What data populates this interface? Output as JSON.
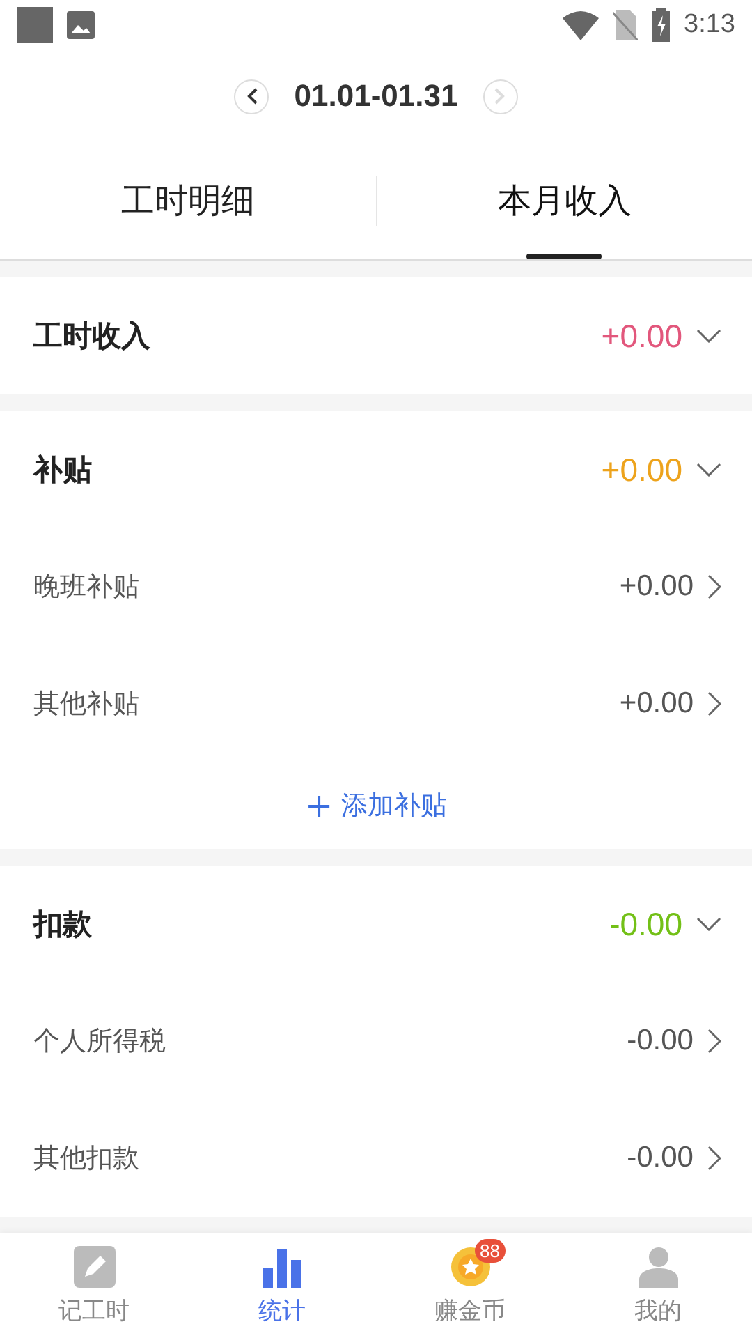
{
  "status_bar": {
    "time": "3:13"
  },
  "period": {
    "range": "01.01-01.31"
  },
  "tabs": [
    {
      "label": "工时明细",
      "selected": false
    },
    {
      "label": "本月收入",
      "selected": true
    }
  ],
  "sections": [
    {
      "title": "工时收入",
      "amount": "+0.00",
      "color": "#e2577c"
    },
    {
      "title": "补贴",
      "amount": "+0.00",
      "color": "#eda31c",
      "items": [
        {
          "label": "晚班补贴",
          "amount": "+0.00"
        },
        {
          "label": "其他补贴",
          "amount": "+0.00"
        }
      ],
      "add_button": {
        "icon": "+",
        "label": "添加补贴"
      }
    },
    {
      "title": "扣款",
      "amount": "-0.00",
      "color": "#73c017",
      "items": [
        {
          "label": "个人所得税",
          "amount": "-0.00"
        },
        {
          "label": "其他扣款",
          "amount": "-0.00"
        }
      ]
    }
  ],
  "bottom_nav": [
    {
      "kind": "pencil",
      "label": "记工时",
      "selected": false
    },
    {
      "kind": "chart",
      "label": "统计",
      "selected": true
    },
    {
      "kind": "coin",
      "label": "赚金币",
      "selected": false,
      "badge": "88"
    },
    {
      "kind": "person",
      "label": "我的",
      "selected": false
    }
  ]
}
